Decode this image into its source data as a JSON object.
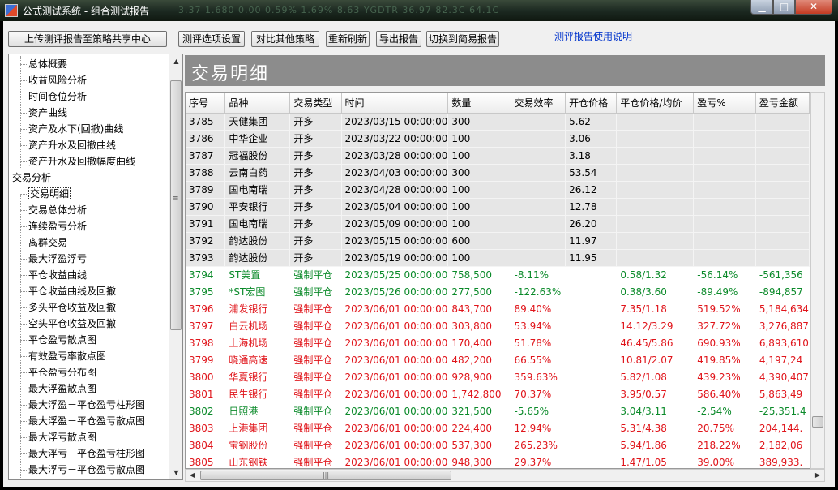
{
  "window": {
    "title": "公式测试系统 - 组合测试报告",
    "bg_ticker": "3.37   1.680   0.00   0.59%   1.69%   8.63   YGDTR   36.97   82.3C   64.1C",
    "min_glyph": "▁",
    "max_glyph": "□",
    "close_glyph": "✕"
  },
  "toolbar": {
    "upload_label": "上传测评报告至策略共享中心",
    "options_label": "测评选项设置",
    "compare_label": "对比其他策略",
    "refresh_label": "重新刷新",
    "export_label": "导出报告",
    "simple_label": "切换到简易报告",
    "help_link": "测评报告使用说明"
  },
  "tree": {
    "group1_children": [
      "总体概要",
      "收益风险分析",
      "时间仓位分析",
      "资产曲线",
      "资产及水下(回撤)曲线",
      "资产升水及回撤曲线",
      "资产升水及回撤幅度曲线"
    ],
    "group2_label": "交易分析",
    "group2_children": [
      "交易明细",
      "交易总体分析",
      "连续盈亏分析",
      "离群交易",
      "最大浮盈浮亏",
      "平仓收益曲线",
      "平仓收益曲线及回撤",
      "多头平仓收益及回撤",
      "空头平仓收益及回撤",
      "平仓盈亏散点图",
      "有效盈亏率散点图",
      "平仓盈亏分布图",
      "最大浮盈散点图",
      "最大浮盈－平仓盈亏柱形图",
      "最大浮盈－平仓盈亏散点图",
      "最大浮亏散点图",
      "最大浮亏－平仓盈亏柱形图",
      "最大浮亏－平仓盈亏散点图"
    ],
    "selected": "交易明细"
  },
  "panel": {
    "title": "交易明细"
  },
  "table": {
    "headers": [
      "序号",
      "品种",
      "交易类型",
      "时间",
      "数量",
      "交易效率",
      "开仓价格",
      "平仓价格/均价",
      "盈亏%",
      "盈亏金额"
    ],
    "rows": [
      {
        "kind": "open",
        "cells": [
          "3785",
          "天健集团",
          "开多",
          "2023/03/15 00:00:00",
          "300",
          "",
          "5.62",
          "",
          "",
          ""
        ]
      },
      {
        "kind": "open",
        "cells": [
          "3786",
          "中华企业",
          "开多",
          "2023/03/22 00:00:00",
          "100",
          "",
          "3.06",
          "",
          "",
          ""
        ]
      },
      {
        "kind": "open",
        "cells": [
          "3787",
          "冠福股份",
          "开多",
          "2023/03/28 00:00:00",
          "100",
          "",
          "3.18",
          "",
          "",
          ""
        ]
      },
      {
        "kind": "open",
        "cells": [
          "3788",
          "云南白药",
          "开多",
          "2023/04/03 00:00:00",
          "300",
          "",
          "53.54",
          "",
          "",
          ""
        ]
      },
      {
        "kind": "open",
        "cells": [
          "3789",
          "国电南瑞",
          "开多",
          "2023/04/28 00:00:00",
          "100",
          "",
          "26.12",
          "",
          "",
          ""
        ]
      },
      {
        "kind": "open",
        "cells": [
          "3790",
          "平安银行",
          "开多",
          "2023/05/04 00:00:00",
          "100",
          "",
          "12.78",
          "",
          "",
          ""
        ]
      },
      {
        "kind": "open",
        "cells": [
          "3791",
          "国电南瑞",
          "开多",
          "2023/05/09 00:00:00",
          "100",
          "",
          "26.20",
          "",
          "",
          ""
        ]
      },
      {
        "kind": "open",
        "cells": [
          "3792",
          "韵达股份",
          "开多",
          "2023/05/15 00:00:00",
          "600",
          "",
          "11.97",
          "",
          "",
          ""
        ]
      },
      {
        "kind": "open",
        "cells": [
          "3793",
          "韵达股份",
          "开多",
          "2023/05/19 00:00:00",
          "100",
          "",
          "11.95",
          "",
          "",
          ""
        ]
      },
      {
        "kind": "loss",
        "cells": [
          "3794",
          "ST美置",
          "强制平仓",
          "2023/05/25 00:00:00",
          "758,500",
          "-8.11%",
          "",
          "0.58/1.32",
          "-56.14%",
          "-561,356"
        ]
      },
      {
        "kind": "loss",
        "cells": [
          "3795",
          "*ST宏图",
          "强制平仓",
          "2023/05/26 00:00:00",
          "277,500",
          "-122.63%",
          "",
          "0.38/3.60",
          "-89.49%",
          "-894,857"
        ]
      },
      {
        "kind": "win",
        "cells": [
          "3796",
          "浦发银行",
          "强制平仓",
          "2023/06/01 00:00:00",
          "843,700",
          "89.40%",
          "",
          "7.35/1.18",
          "519.52%",
          "5,184,634"
        ]
      },
      {
        "kind": "win",
        "cells": [
          "3797",
          "白云机场",
          "强制平仓",
          "2023/06/01 00:00:00",
          "303,800",
          "53.94%",
          "",
          "14.12/3.29",
          "327.72%",
          "3,276,887"
        ]
      },
      {
        "kind": "win",
        "cells": [
          "3798",
          "上海机场",
          "强制平仓",
          "2023/06/01 00:00:00",
          "170,400",
          "51.78%",
          "",
          "46.45/5.86",
          "690.93%",
          "6,893,610"
        ]
      },
      {
        "kind": "win",
        "cells": [
          "3799",
          "晓通高速",
          "强制平仓",
          "2023/06/01 00:00:00",
          "482,200",
          "66.55%",
          "",
          "10.81/2.07",
          "419.85%",
          "4,197,24"
        ]
      },
      {
        "kind": "win",
        "cells": [
          "3800",
          "华夏银行",
          "强制平仓",
          "2023/06/01 00:00:00",
          "928,900",
          "359.63%",
          "",
          "5.82/1.08",
          "439.23%",
          "4,390,407"
        ]
      },
      {
        "kind": "win",
        "cells": [
          "3801",
          "民生银行",
          "强制平仓",
          "2023/06/01 00:00:00",
          "1,742,800",
          "70.37%",
          "",
          "3.95/0.57",
          "586.40%",
          "5,863,49"
        ]
      },
      {
        "kind": "loss",
        "cells": [
          "3802",
          "日照港",
          "强制平仓",
          "2023/06/01 00:00:00",
          "321,500",
          "-5.65%",
          "",
          "3.04/3.11",
          "-2.54%",
          "-25,351.4"
        ]
      },
      {
        "kind": "win",
        "cells": [
          "3803",
          "上港集团",
          "强制平仓",
          "2023/06/01 00:00:00",
          "224,400",
          "12.94%",
          "",
          "5.31/4.38",
          "20.75%",
          "204,144."
        ]
      },
      {
        "kind": "win",
        "cells": [
          "3804",
          "宝钢股份",
          "强制平仓",
          "2023/06/01 00:00:00",
          "537,300",
          "265.23%",
          "",
          "5.94/1.86",
          "218.22%",
          "2,182,06"
        ]
      },
      {
        "kind": "win",
        "cells": [
          "3805",
          "山东钢铁",
          "强制平仓",
          "2023/06/01 00:00:00",
          "948,300",
          "29.37%",
          "",
          "1.47/1.05",
          "39.00%",
          "389,933."
        ]
      }
    ]
  },
  "scrollbar": {
    "up": "▲",
    "down": "▼",
    "left": "◀",
    "right": "▶",
    "grip": "≡",
    "hgrip": "|||"
  }
}
